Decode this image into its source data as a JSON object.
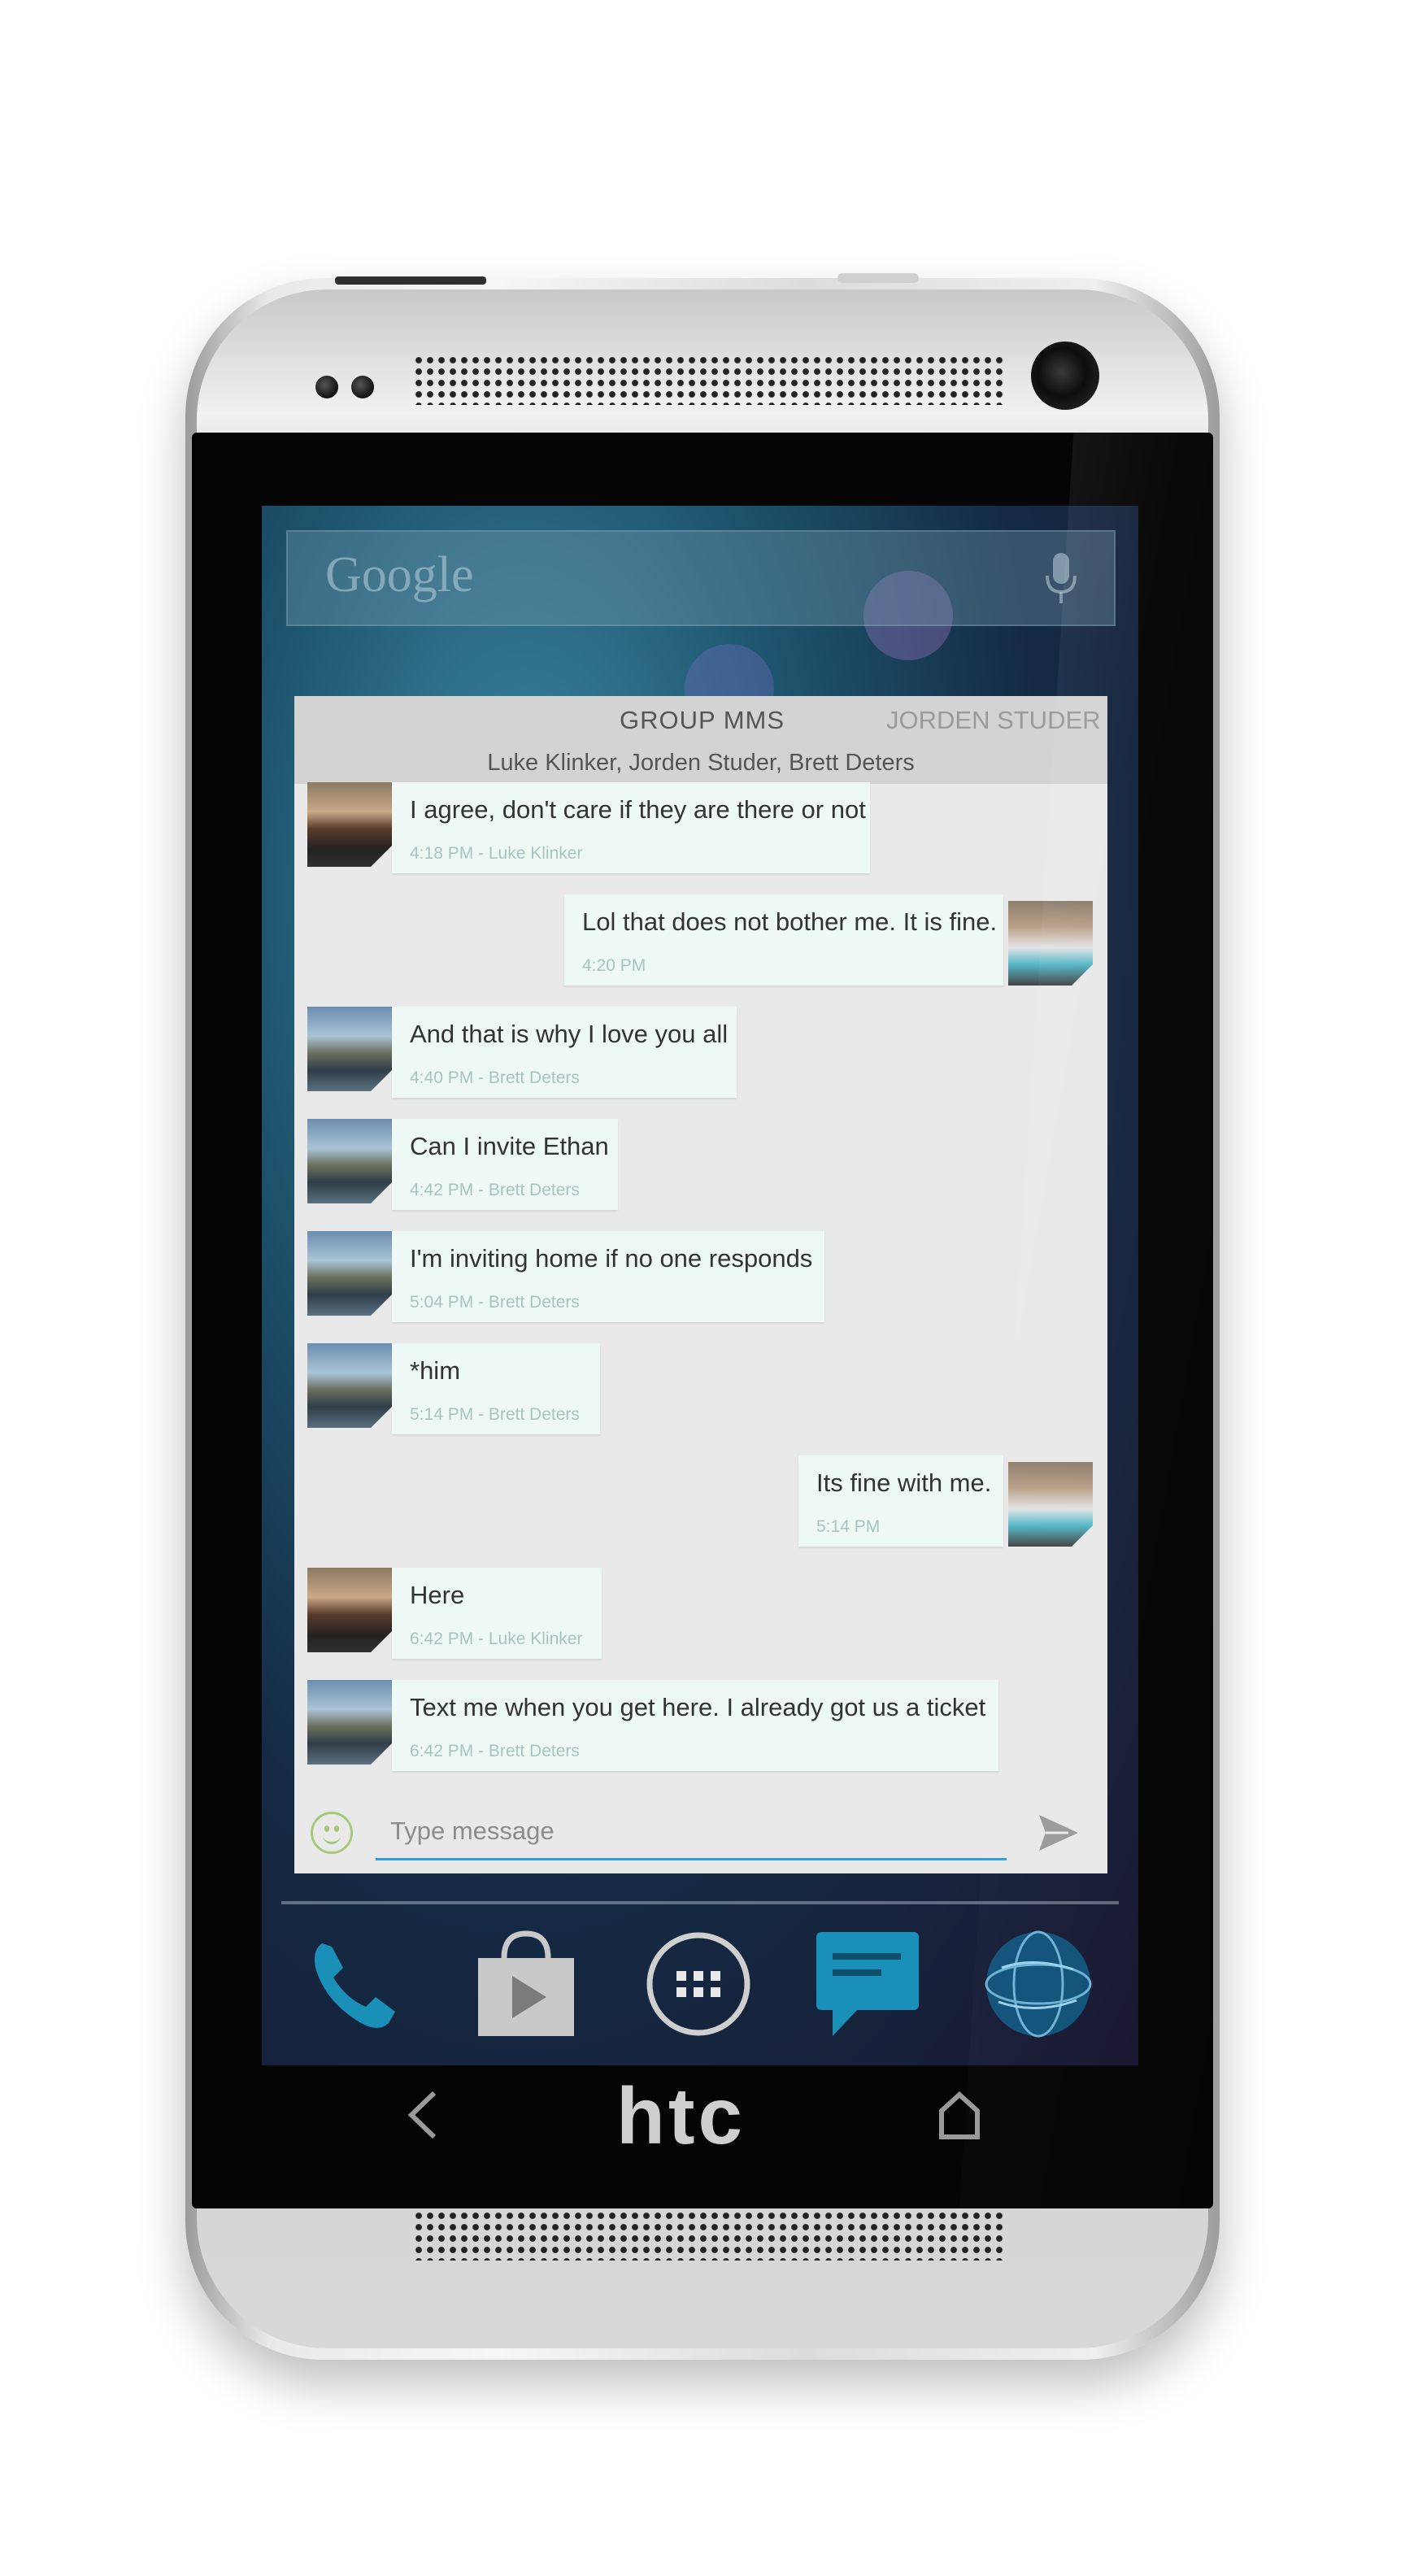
{
  "device": {
    "brand_logo": "htc"
  },
  "homescreen": {
    "search_logo": "Google",
    "mic_icon": "microphone-icon",
    "dock": [
      "phone-icon",
      "play-store-icon",
      "app-drawer-icon",
      "messaging-icon",
      "browser-globe-icon"
    ]
  },
  "conversation": {
    "tabs": {
      "active": "GROUP MMS",
      "next": "JORDEN STUDER"
    },
    "participants": "Luke Klinker, Jorden Studer, Brett Deters",
    "messages": [
      {
        "text": "I agree, don't care if they are there or not",
        "meta": "4:18 PM - Luke Klinker",
        "sender": "Luke Klinker",
        "outgoing": false
      },
      {
        "text": "Lol that does not bother me. It is fine.",
        "meta": "4:20 PM",
        "sender": "me",
        "outgoing": true
      },
      {
        "text": "And that is why I love you all",
        "meta": "4:40 PM - Brett Deters",
        "sender": "Brett Deters",
        "outgoing": false
      },
      {
        "text": "Can I invite Ethan",
        "meta": "4:42 PM - Brett Deters",
        "sender": "Brett Deters",
        "outgoing": false
      },
      {
        "text": "I'm inviting home if no one responds",
        "meta": "5:04 PM - Brett Deters",
        "sender": "Brett Deters",
        "outgoing": false
      },
      {
        "text": "*him",
        "meta": "5:14 PM - Brett Deters",
        "sender": "Brett Deters",
        "outgoing": false
      },
      {
        "text": "Its fine with me.",
        "meta": "5:14 PM",
        "sender": "me",
        "outgoing": true
      },
      {
        "text": "Here",
        "meta": "6:42 PM - Luke Klinker",
        "sender": "Luke Klinker",
        "outgoing": false
      },
      {
        "text": "Text me when you get here. I already got us a ticket",
        "meta": "6:42 PM - Brett Deters",
        "sender": "Brett Deters",
        "outgoing": false
      }
    ],
    "composer": {
      "placeholder": "Type message",
      "value": ""
    }
  },
  "colors": {
    "accent": "#2d9fd6",
    "bubble": "#eef9f6",
    "emoji": "#a6c97b"
  }
}
